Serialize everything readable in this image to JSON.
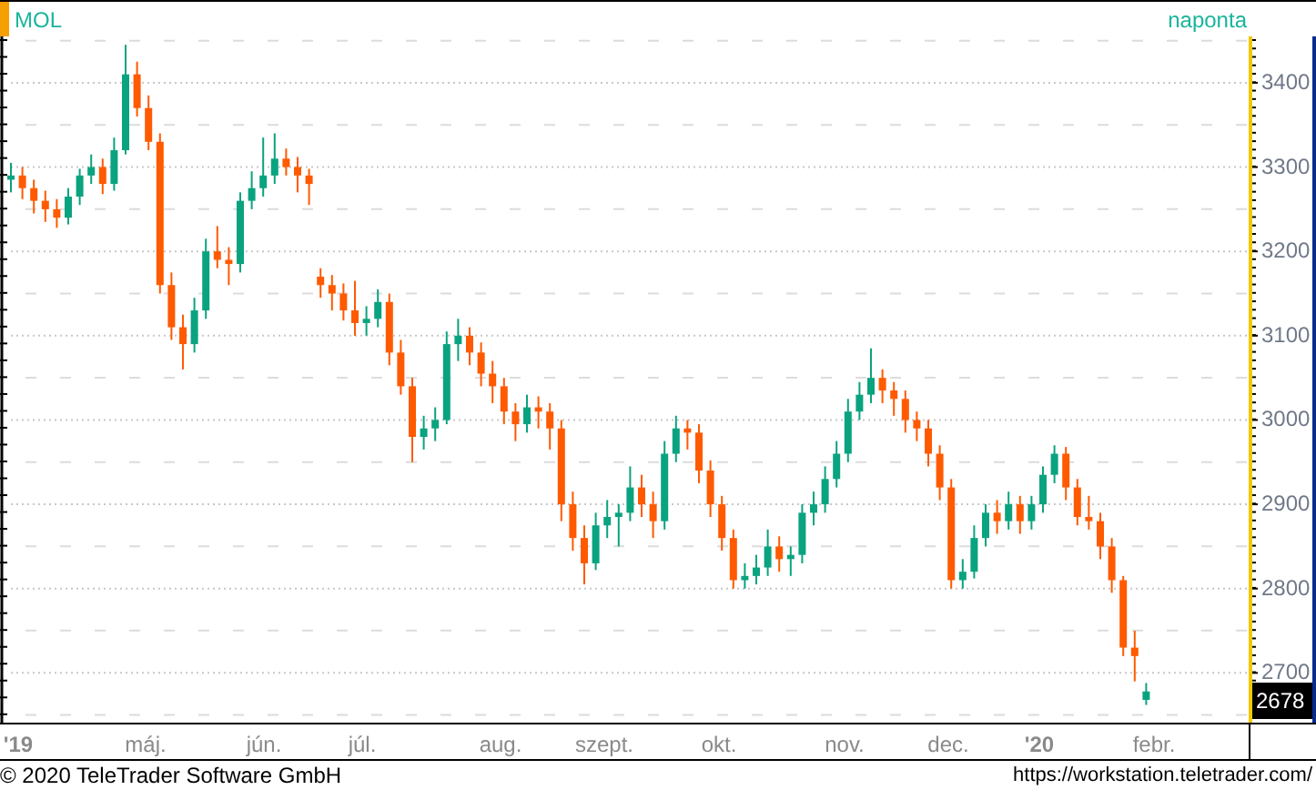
{
  "header": {
    "symbol": "MOL",
    "interval": "naponta"
  },
  "chart": {
    "last_price": "2678",
    "chart_data": {
      "type": "candlestick",
      "categories": [
        null,
        null,
        null,
        null,
        null,
        null,
        null,
        null,
        null,
        null,
        null,
        null,
        null,
        null,
        null,
        null,
        null,
        null,
        null,
        null,
        null,
        null,
        null,
        null,
        null,
        null,
        null,
        null,
        null,
        null,
        null,
        null,
        null,
        null,
        null,
        null,
        null,
        null,
        null,
        null,
        null,
        null,
        null,
        null,
        null,
        null,
        null,
        null,
        null,
        null,
        null,
        null,
        null,
        null,
        null,
        null,
        null,
        null,
        null,
        null,
        null,
        null,
        null,
        null,
        null,
        null,
        null,
        null,
        null,
        null,
        null,
        null,
        null,
        null,
        null,
        null,
        null,
        null,
        null,
        null,
        null,
        null,
        null,
        null,
        null,
        null,
        null,
        null,
        null,
        null,
        null,
        null,
        null,
        null,
        null,
        null,
        null,
        null,
        null,
        null
      ],
      "ohlc": [
        [
          3285,
          3305,
          3270,
          3290
        ],
        [
          3290,
          3300,
          3262,
          3275
        ],
        [
          3275,
          3285,
          3245,
          3260
        ],
        [
          3260,
          3272,
          3235,
          3250
        ],
        [
          3250,
          3262,
          3228,
          3240
        ],
        [
          3240,
          3275,
          3232,
          3265
        ],
        [
          3265,
          3298,
          3255,
          3290
        ],
        [
          3290,
          3315,
          3280,
          3300
        ],
        [
          3300,
          3310,
          3268,
          3280
        ],
        [
          3280,
          3335,
          3272,
          3320
        ],
        [
          3320,
          3445,
          3315,
          3410
        ],
        [
          3410,
          3425,
          3360,
          3370
        ],
        [
          3370,
          3385,
          3320,
          3330
        ],
        [
          3330,
          3340,
          3150,
          3160
        ],
        [
          3160,
          3175,
          3095,
          3110
        ],
        [
          3110,
          3125,
          3060,
          3090
        ],
        [
          3090,
          3145,
          3080,
          3130
        ],
        [
          3130,
          3215,
          3120,
          3200
        ],
        [
          3200,
          3230,
          3180,
          3190
        ],
        [
          3190,
          3205,
          3160,
          3185
        ],
        [
          3185,
          3270,
          3175,
          3260
        ],
        [
          3260,
          3295,
          3250,
          3275
        ],
        [
          3275,
          3335,
          3265,
          3290
        ],
        [
          3290,
          3340,
          3280,
          3310
        ],
        [
          3310,
          3322,
          3290,
          3300
        ],
        [
          3300,
          3312,
          3270,
          3290
        ],
        [
          3290,
          3298,
          3255,
          3280
        ],
        [
          3170,
          3180,
          3145,
          3160
        ],
        [
          3160,
          3172,
          3130,
          3150
        ],
        [
          3150,
          3162,
          3118,
          3130
        ],
        [
          3130,
          3165,
          3100,
          3115
        ],
        [
          3115,
          3135,
          3100,
          3120
        ],
        [
          3120,
          3155,
          3110,
          3140
        ],
        [
          3140,
          3150,
          3065,
          3080
        ],
        [
          3080,
          3095,
          3030,
          3040
        ],
        [
          3040,
          3050,
          2950,
          2980
        ],
        [
          2980,
          3005,
          2965,
          2990
        ],
        [
          2990,
          3015,
          2975,
          3000
        ],
        [
          3000,
          3105,
          2995,
          3090
        ],
        [
          3090,
          3120,
          3070,
          3100
        ],
        [
          3100,
          3110,
          3065,
          3080
        ],
        [
          3080,
          3092,
          3040,
          3055
        ],
        [
          3055,
          3070,
          3020,
          3040
        ],
        [
          3040,
          3050,
          2995,
          3010
        ],
        [
          3010,
          3020,
          2975,
          2995
        ],
        [
          2995,
          3030,
          2985,
          3015
        ],
        [
          3015,
          3028,
          2990,
          3010
        ],
        [
          3010,
          3020,
          2965,
          2990
        ],
        [
          2990,
          3000,
          2880,
          2900
        ],
        [
          2900,
          2915,
          2845,
          2860
        ],
        [
          2860,
          2875,
          2805,
          2830
        ],
        [
          2830,
          2890,
          2822,
          2875
        ],
        [
          2875,
          2905,
          2860,
          2885
        ],
        [
          2885,
          2900,
          2850,
          2890
        ],
        [
          2890,
          2945,
          2880,
          2920
        ],
        [
          2920,
          2935,
          2885,
          2900
        ],
        [
          2900,
          2915,
          2860,
          2880
        ],
        [
          2880,
          2975,
          2870,
          2960
        ],
        [
          2960,
          3005,
          2950,
          2990
        ],
        [
          2990,
          3000,
          2965,
          2985
        ],
        [
          2985,
          2995,
          2925,
          2940
        ],
        [
          2940,
          2952,
          2885,
          2900
        ],
        [
          2900,
          2910,
          2845,
          2860
        ],
        [
          2860,
          2870,
          2800,
          2810
        ],
        [
          2810,
          2830,
          2800,
          2815
        ],
        [
          2815,
          2840,
          2805,
          2825
        ],
        [
          2825,
          2870,
          2815,
          2850
        ],
        [
          2850,
          2862,
          2820,
          2835
        ],
        [
          2835,
          2850,
          2815,
          2840
        ],
        [
          2840,
          2900,
          2830,
          2890
        ],
        [
          2890,
          2915,
          2875,
          2900
        ],
        [
          2900,
          2945,
          2890,
          2930
        ],
        [
          2930,
          2975,
          2920,
          2960
        ],
        [
          2960,
          3025,
          2950,
          3010
        ],
        [
          3010,
          3045,
          3000,
          3030
        ],
        [
          3030,
          3085,
          3020,
          3050
        ],
        [
          3050,
          3060,
          3020,
          3035
        ],
        [
          3035,
          3045,
          3005,
          3025
        ],
        [
          3025,
          3035,
          2985,
          3000
        ],
        [
          3000,
          3010,
          2975,
          2990
        ],
        [
          2990,
          3000,
          2945,
          2960
        ],
        [
          2960,
          2970,
          2905,
          2920
        ],
        [
          2920,
          2930,
          2800,
          2810
        ],
        [
          2810,
          2835,
          2800,
          2820
        ],
        [
          2820,
          2875,
          2812,
          2860
        ],
        [
          2860,
          2900,
          2850,
          2890
        ],
        [
          2890,
          2905,
          2865,
          2880
        ],
        [
          2880,
          2915,
          2870,
          2900
        ],
        [
          2900,
          2910,
          2865,
          2880
        ],
        [
          2880,
          2910,
          2870,
          2900
        ],
        [
          2900,
          2945,
          2890,
          2935
        ],
        [
          2935,
          2970,
          2925,
          2960
        ],
        [
          2960,
          2968,
          2905,
          2920
        ],
        [
          2920,
          2930,
          2875,
          2885
        ],
        [
          2885,
          2910,
          2870,
          2880
        ],
        [
          2880,
          2890,
          2835,
          2850
        ],
        [
          2850,
          2860,
          2795,
          2810
        ],
        [
          2810,
          2815,
          2720,
          2730
        ],
        [
          2730,
          2750,
          2690,
          2720
        ],
        [
          2668,
          2688,
          2662,
          2678
        ]
      ],
      "grid": true,
      "ylim": [
        2641,
        3455
      ],
      "yticks": [
        {
          "value": 3400,
          "label": "3400"
        },
        {
          "value": 3300,
          "label": "3300"
        },
        {
          "value": 3200,
          "label": "3200"
        },
        {
          "value": 3100,
          "label": "3100"
        },
        {
          "value": 3000,
          "label": "3000"
        },
        {
          "value": 2900,
          "label": "2900"
        },
        {
          "value": 2800,
          "label": "2800"
        },
        {
          "value": 2700,
          "label": "2700"
        }
      ]
    },
    "x_axis": {
      "labels": [
        {
          "text": "'19",
          "kind": "year"
        },
        {
          "text": "máj.",
          "kind": "month"
        },
        {
          "text": "jún.",
          "kind": "month"
        },
        {
          "text": "júl.",
          "kind": "month"
        },
        {
          "text": "aug.",
          "kind": "month"
        },
        {
          "text": "szept.",
          "kind": "month"
        },
        {
          "text": "okt.",
          "kind": "month"
        },
        {
          "text": "nov.",
          "kind": "month"
        },
        {
          "text": "dec.",
          "kind": "month"
        },
        {
          "text": "'20",
          "kind": "year"
        },
        {
          "text": "febr.",
          "kind": "month"
        }
      ]
    }
  },
  "footer": {
    "copyright": "© 2020 TeleTrader Software GmbH",
    "url": "https://workstation.teletrader.com/"
  }
}
